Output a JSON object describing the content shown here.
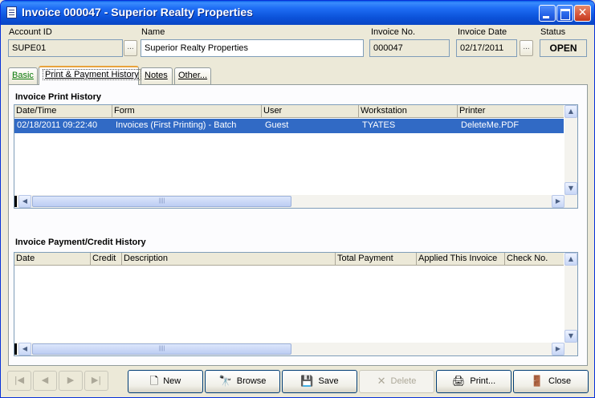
{
  "window": {
    "title": "Invoice  000047 - Superior Realty Properties"
  },
  "header": {
    "account_id_label": "Account ID",
    "account_id": "SUPE01",
    "name_label": "Name",
    "name": "Superior Realty Properties",
    "invoice_no_label": "Invoice No.",
    "invoice_no": "000047",
    "invoice_date_label": "Invoice Date",
    "invoice_date": "02/17/2011",
    "status_label": "Status",
    "status": "OPEN",
    "ellipsis": "..."
  },
  "tabs": [
    {
      "label": "Basic"
    },
    {
      "label": "Print & Payment History"
    },
    {
      "label": "Notes"
    },
    {
      "label": "Other..."
    }
  ],
  "print_history": {
    "title": "Invoice Print History",
    "columns": [
      "Date/Time",
      "Form",
      "User",
      "Workstation",
      "Printer"
    ],
    "rows": [
      [
        "02/18/2011 09:22:40",
        "Invoices (First Printing) - Batch",
        "Guest",
        "TYATES",
        "DeleteMe.PDF"
      ]
    ]
  },
  "payment_history": {
    "title": "Invoice Payment/Credit History",
    "columns": [
      "Date",
      "Credit",
      "Description",
      "Total Payment",
      "Applied This Invoice",
      "Check No."
    ]
  },
  "scroll": {
    "thumb_grip": "||||"
  },
  "nav": {
    "first": "|◀",
    "prev": "◀",
    "next": "▶",
    "last": "▶|"
  },
  "buttons": {
    "new": "New",
    "browse": "Browse",
    "save": "Save",
    "delete": "Delete",
    "print": "Print...",
    "close": "Close"
  },
  "icons": {
    "up": "▲",
    "down": "▼",
    "left": "◀",
    "right": "▶",
    "new": "🗋",
    "browse": "🔭",
    "save": "💾",
    "delete": "✕",
    "print": "🖨",
    "close": "🚪",
    "close_x": "✕"
  }
}
